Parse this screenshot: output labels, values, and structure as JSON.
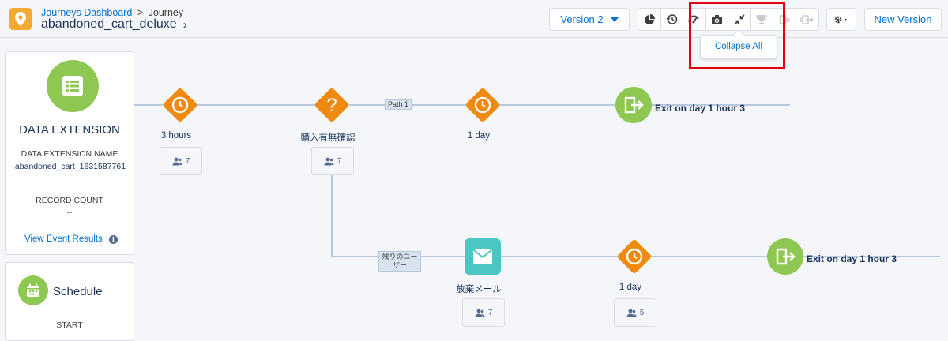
{
  "header": {
    "breadcrumb_root": "Journeys Dashboard",
    "breadcrumb_sep": ">",
    "breadcrumb_current": "Journey",
    "journey_name": "abandoned_cart_deluxe",
    "journey_chevron": "›",
    "version_label": "Version 2",
    "toolbar_icons": [
      "goal-pie-icon",
      "history-icon",
      "test-icon",
      "snapshot-icon",
      "collapse-all-icon",
      "trophy-icon",
      "exit-icon",
      "exit-criteria-icon"
    ],
    "gear_icon": "gear-icon",
    "new_version_label": "New Version",
    "tooltip": "Collapse All"
  },
  "left_panel": {
    "title": "DATA EXTENSION",
    "name_label": "DATA EXTENSION NAME",
    "name_value": "abandoned_cart_1631587761",
    "record_count_label": "RECORD COUNT",
    "record_count_value": "--",
    "event_results_link": "View Event Results",
    "info_glyph": "i"
  },
  "schedule_panel": {
    "title": "Schedule",
    "start_label": "START"
  },
  "canvas": {
    "nodes": [
      {
        "label": "3 hours",
        "count": "7"
      },
      {
        "label": "購入有無確認",
        "count": "7"
      },
      {
        "label": "1 day",
        "count": ""
      },
      {
        "label": "放棄メール",
        "count": "7"
      },
      {
        "label": "1 day",
        "count": "5"
      }
    ],
    "paths": [
      {
        "label": "Path 1"
      },
      {
        "label": "残りのユーザー"
      }
    ],
    "exits": [
      {
        "label": "Exit on day 1 hour 3"
      },
      {
        "label": "Exit on day 1 hour 3"
      }
    ],
    "decision_glyph": "?"
  },
  "colors": {
    "orange": "#f08a0e",
    "green": "#8ec852",
    "teal": "#4bc6c2",
    "link": "#0070d2",
    "highlight": "#e0000f"
  }
}
